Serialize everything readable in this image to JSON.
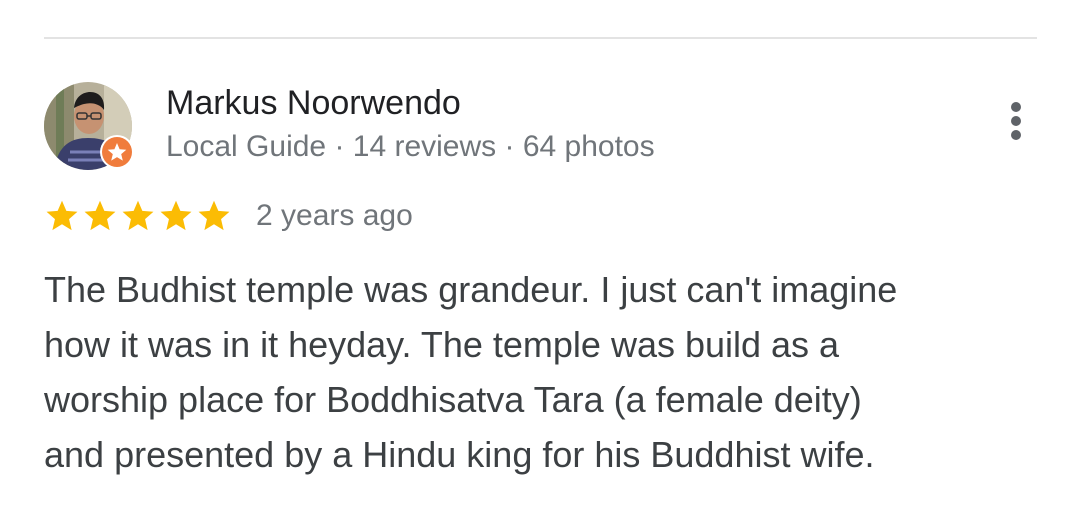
{
  "review": {
    "reviewer_name": "Markus Noorwendo",
    "reviewer_meta": "Local Guide · 14 reviews · 64 photos",
    "rating": 5,
    "rating_max": 5,
    "date": "2 years ago",
    "text": "The Budhist temple was grandeur. I just can't imagine\nhow it was in it heyday. The temple was build as a\nworship place for Boddhisatva Tara (a female deity)\nand presented by a Hindu king for his Buddhist wife."
  },
  "icons": {
    "badge": "local-guide-badge-icon",
    "more": "more-vert-icon",
    "star": "star-icon"
  },
  "colors": {
    "star": "#fbbc04",
    "badge": "#f07c3c",
    "name": "#202124",
    "meta": "#70757a",
    "body": "#3c4043"
  }
}
